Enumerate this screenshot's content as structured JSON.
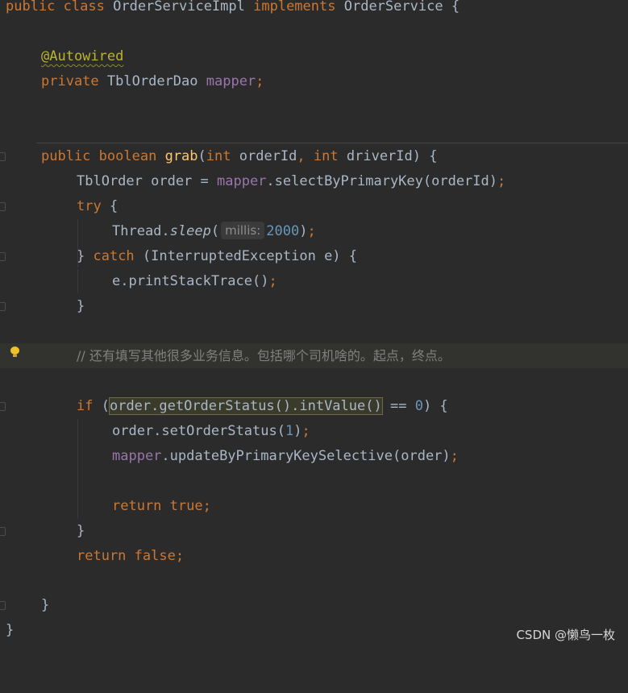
{
  "editor": {
    "lines": {
      "class_decl": {
        "kw1": "public",
        "kw2": "class",
        "name": "OrderServiceImpl",
        "kw3": "implements",
        "iface": "OrderService",
        "brace": "{"
      },
      "annotation": {
        "text": "@Autowired"
      },
      "field_decl": {
        "kw": "private",
        "type": "TblOrderDao",
        "name": "mapper",
        "semi": ";"
      },
      "method_decl": {
        "kw1": "public",
        "kw2": "boolean",
        "name": "grab",
        "p1": "(",
        "t1": "int",
        "a1": "orderId",
        ", ": ", ",
        "t2": "int",
        "a2": "driverId",
        "close": ") {"
      },
      "select_line": {
        "type": "TblOrder order = ",
        "obj": "mapper",
        ".selectByPrimaryKey(orderId)": ".selectByPrimaryKey(orderId)",
        "semi": ";"
      },
      "try_line": {
        "kw": "try",
        "rest": " {"
      },
      "sleep_line": {
        "pre": "Thread.",
        "call": "sleep",
        "open": "(",
        "hint": "millis:",
        "val": "2000",
        "close": ")",
        "semi": ";"
      },
      "catch_line": {
        "pre": "} ",
        "kw": "catch",
        "rest": " (InterruptedException e) {"
      },
      "print_line": {
        "text": "e.printStackTrace()",
        "semi": ";"
      },
      "close1": {
        "text": "}"
      },
      "comment_line": {
        "text": "// 还有填写其他很多业务信息。包括哪个司机啥的。起点，终点。"
      },
      "if_line": {
        "kw": "if",
        "open": " (",
        "expr": "order.getOrderStatus().intValue()",
        "op": " == ",
        "num": "0",
        "close": ") {"
      },
      "set_line": {
        "text": "order.setOrderStatus(",
        "num": "1",
        "close": ")",
        "semi": ";"
      },
      "update_line": {
        "obj": "mapper",
        "rest": ".updateByPrimaryKeySelective(order)",
        "semi": ";"
      },
      "return_true": {
        "kw": "return",
        "val": "true",
        "semi": ";"
      },
      "close2": {
        "text": "}"
      },
      "return_false": {
        "kw": "return",
        "val": "false",
        "semi": ";"
      },
      "close3": {
        "text": "}"
      },
      "close4": {
        "text": "}"
      }
    }
  },
  "watermark": {
    "text": "CSDN @懒鸟一枚"
  },
  "colors": {
    "background": "#2b2b2b",
    "keyword": "#cc7832",
    "annotation": "#bbb529",
    "field": "#9876aa",
    "method": "#ffc66d",
    "number": "#6897bb",
    "comment": "#808080",
    "text": "#a9b7c6"
  },
  "icons": {
    "gutter": "fold-marker-icon",
    "intention": "lightbulb-icon"
  }
}
